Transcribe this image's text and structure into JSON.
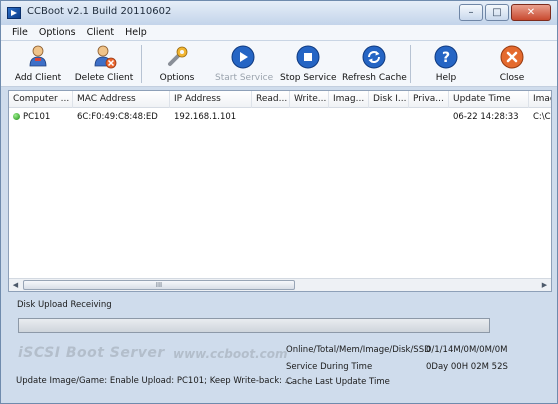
{
  "window": {
    "title": "CCBoot v2.1 Build 20110602",
    "controls": {
      "minimize": "–",
      "maximize": "□",
      "close": "✕"
    }
  },
  "menu": [
    "File",
    "Options",
    "Client",
    "Help"
  ],
  "toolbar": {
    "add_client": "Add Client",
    "delete_client": "Delete Client",
    "options": "Options",
    "start_service": "Start Service",
    "stop_service": "Stop Service",
    "refresh_cache": "Refresh Cache",
    "help": "Help",
    "close": "Close"
  },
  "table": {
    "columns": [
      "Computer ...",
      "MAC Address",
      "IP Address",
      "Read...",
      "Write...",
      "Imag...",
      "Disk I...",
      "Priva...",
      "Update Time",
      "Imag"
    ],
    "rows": [
      {
        "status": "online",
        "computer": "PC101",
        "mac": "6C:F0:49:C8:48:ED",
        "ip": "192.168.1.101",
        "read": "",
        "write": "",
        "image": "",
        "disk": "",
        "private": "",
        "update_time": "06-22 14:28:33",
        "image2": "C:\\C"
      }
    ]
  },
  "scrollbar": {
    "left": "◀",
    "grip": "III",
    "right": "▶"
  },
  "bottom": {
    "upload_label": "Disk Upload Receiving",
    "upload_progress": 0,
    "brand": "iSCSI Boot Server",
    "url": "www.ccboot.com",
    "stats": [
      {
        "label": "Online/Total/Mem/Image/Disk/SSD",
        "value": "0/1/14M/0M/0M/0M"
      },
      {
        "label": "Service During Time",
        "value": "0Day 00H 02M 52S"
      },
      {
        "label": "Cache Last Update Time",
        "value": ""
      }
    ],
    "update_note": "Update Image/Game:  Enable Upload: PC101; Keep Write-back: ..."
  },
  "colors": {
    "accent": "#2c6fc9",
    "online": "#1d8a13",
    "close": "#d9532c"
  }
}
